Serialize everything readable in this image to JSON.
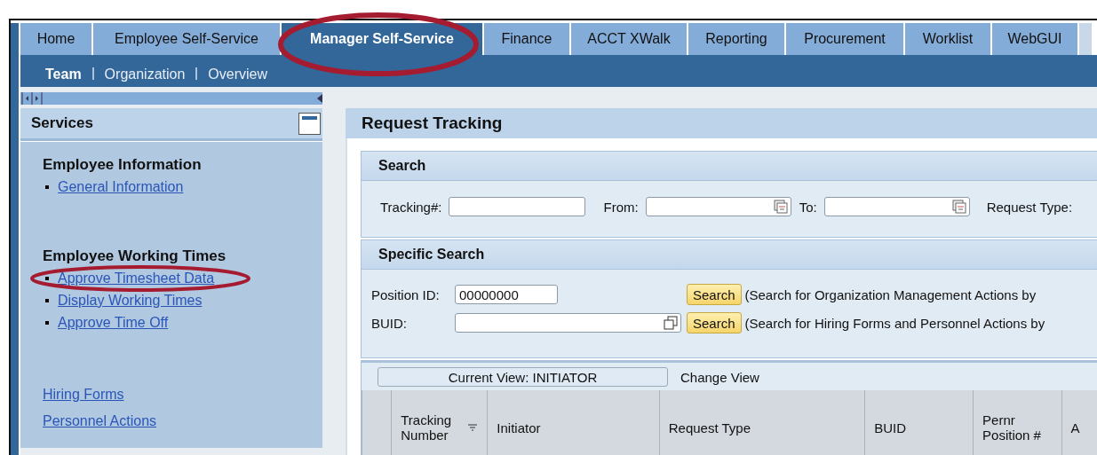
{
  "top_tabs": [
    {
      "label": "Home",
      "selected": false
    },
    {
      "label": "Employee Self-Service",
      "selected": false
    },
    {
      "label": "Manager Self-Service",
      "selected": true
    },
    {
      "label": "Finance",
      "selected": false
    },
    {
      "label": "ACCT XWalk",
      "selected": false
    },
    {
      "label": "Reporting",
      "selected": false
    },
    {
      "label": "Procurement",
      "selected": false
    },
    {
      "label": "Worklist",
      "selected": false
    },
    {
      "label": "WebGUI",
      "selected": false
    }
  ],
  "sub_nav": [
    {
      "label": "Team",
      "selected": true
    },
    {
      "label": "Organization",
      "selected": false
    },
    {
      "label": "Overview",
      "selected": false
    }
  ],
  "sidebar": {
    "title": "Services",
    "groups": [
      {
        "heading": "Employee Information",
        "links": [
          "General Information"
        ]
      },
      {
        "heading": "Employee Working Times",
        "links": [
          "Approve Timesheet Data",
          "Display Working Times",
          "Approve Time Off"
        ]
      }
    ],
    "links": [
      "Hiring Forms",
      "Personnel Actions"
    ]
  },
  "main": {
    "title": "Request Tracking",
    "search": {
      "title": "Search",
      "fields": [
        {
          "label": "Tracking#:",
          "kind": "text"
        },
        {
          "label": "From:",
          "kind": "date"
        },
        {
          "label": "To:",
          "kind": "date"
        },
        {
          "label": "Request Type:",
          "kind": "label"
        }
      ]
    },
    "specific_search": {
      "title": "Specific Search",
      "rows": [
        {
          "label": "Position ID:",
          "value": "00000000",
          "kind": "text",
          "button": "Search",
          "note": "(Search for Organization Management Actions by"
        },
        {
          "label": "BUID:",
          "kind": "lookup",
          "button": "Search",
          "note": "(Search for Hiring Forms and Personnel Actions by"
        }
      ]
    },
    "view_button": "Current View: INITIATOR",
    "change_view": "Change View",
    "table": {
      "columns": [
        {
          "label": "Tracking Number",
          "sortable": true
        },
        {
          "label": "Initiator",
          "sortable": false
        },
        {
          "label": "Request Type",
          "sortable": false
        },
        {
          "label": "BUID",
          "sortable": false
        },
        {
          "label": "Pernr Position #",
          "sortable": false
        },
        {
          "label": "A",
          "sortable": false
        }
      ]
    }
  }
}
